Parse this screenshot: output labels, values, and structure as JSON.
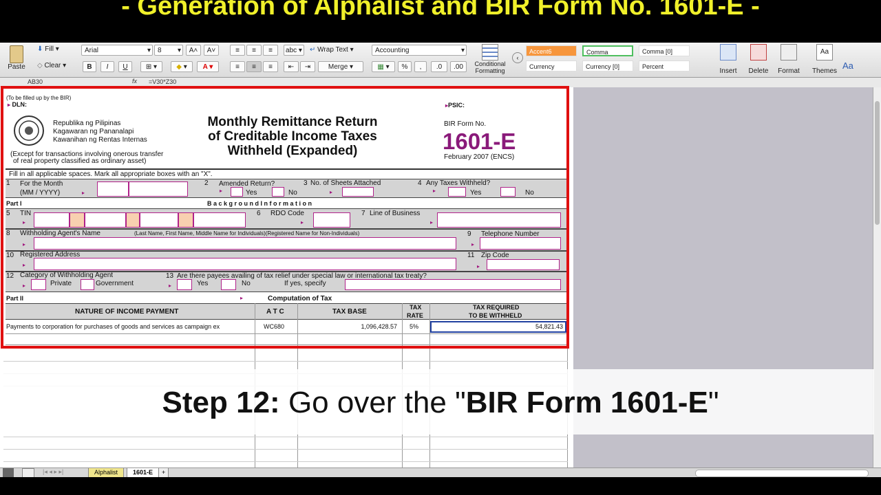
{
  "banner": {
    "title": "- Generation of Alphalist and BIR Form No. 1601-E -"
  },
  "ribbon": {
    "paste": "Paste",
    "fill": "Fill",
    "clear": "Clear",
    "font_name": "Arial",
    "font_size": "8",
    "bold": "B",
    "italic": "I",
    "underline": "U",
    "wrap_text": "Wrap Text",
    "merge": "Merge",
    "abc": "abc",
    "number_format": "Accounting",
    "conditional": "Conditional",
    "formatting": "Formatting",
    "percent": "%",
    "styles": [
      "Accent6",
      "Comma",
      "Comma [0]",
      "Currency",
      "Currency [0]",
      "Percent"
    ],
    "insert": "Insert",
    "delete": "Delete",
    "format": "Format",
    "themes": "Themes",
    "aa": "Aa"
  },
  "formula_bar": {
    "cell_ref": "AB30",
    "fx": "fx",
    "formula": "=V30*Z30"
  },
  "form": {
    "bir_note": "(To be filled up by the BIR)",
    "dln": "DLN:",
    "psic": "PSIC:",
    "agency_lines": [
      "Republika ng Pilipinas",
      "Kagawaran ng Pananalapi",
      "Kawanihan ng Rentas Internas"
    ],
    "exception_lines": [
      "(Except for transactions involving onerous transfer",
      "of real property classified as ordinary asset)"
    ],
    "title_lines": [
      "Monthly Remittance Return",
      "of Creditable  Income Taxes",
      "Withheld (Expanded)"
    ],
    "form_no_label": "BIR Form No.",
    "form_no": "1601-E",
    "form_date": "February 2007 (ENCS)",
    "instructions": "Fill in all applicable spaces. Mark all appropriate boxes with an \"X\".",
    "row1": {
      "n1": "1",
      "month_label": "For the Month",
      "month_fmt": "(MM / YYYY)",
      "n2": "2",
      "amended": "Amended Return?",
      "yes": "Yes",
      "no": "No",
      "n3": "3",
      "sheets": "No. of  Sheets Attached",
      "n4": "4",
      "taxes_withheld": "Any Taxes Withheld?"
    },
    "part1": {
      "label": "Part I",
      "title": "B a c k g r o u n d    I n f o r m a t i o n"
    },
    "row5": {
      "n5": "5",
      "tin": "TIN",
      "n6": "6",
      "rdo": "RDO Code",
      "n7": "7",
      "lob": "Line of Business"
    },
    "row8": {
      "n8": "8",
      "agent_name": "Withholding Agent's Name",
      "name_hint": "(Last Name, First Name, Middle Name for Individuals)(Registered Name for Non-Individuals)",
      "n9": "9",
      "phone": "Telephone Number"
    },
    "row10": {
      "n10": "10",
      "address": "Registered Address",
      "n11": "11",
      "zip": "Zip Code"
    },
    "row12": {
      "n12": "12",
      "category": "Category of Withholding Agent",
      "private": "Private",
      "government": "Government",
      "n13": "13",
      "relief": "Are there payees availing of tax relief under special law or international tax treaty?",
      "yes": "Yes",
      "no": "No",
      "specify": "If yes, specify"
    },
    "part2": {
      "label": "Part II",
      "title": "Computation of Tax"
    },
    "table_headers": {
      "nature": "NATURE OF INCOME PAYMENT",
      "atc": "A T C",
      "tax_base": "TAX BASE",
      "rate1": "TAX",
      "rate2": "RATE",
      "req1": "TAX REQUIRED",
      "req2": "TO BE WITHHELD"
    },
    "rows": [
      {
        "nature": "Payments to corporation for purchases of goods and services as campaign ex",
        "atc": "WC680",
        "tax_base": "1,096,428.57",
        "rate": "5%",
        "withheld": "54,821.43"
      }
    ]
  },
  "caption": {
    "step": "Step 12:",
    "text": " Go over the \"",
    "bold_text": "BIR Form 1601-E",
    "end": "\""
  },
  "sheet_tabs": [
    "Alphalist",
    "1601-E"
  ],
  "add_tab": "+"
}
